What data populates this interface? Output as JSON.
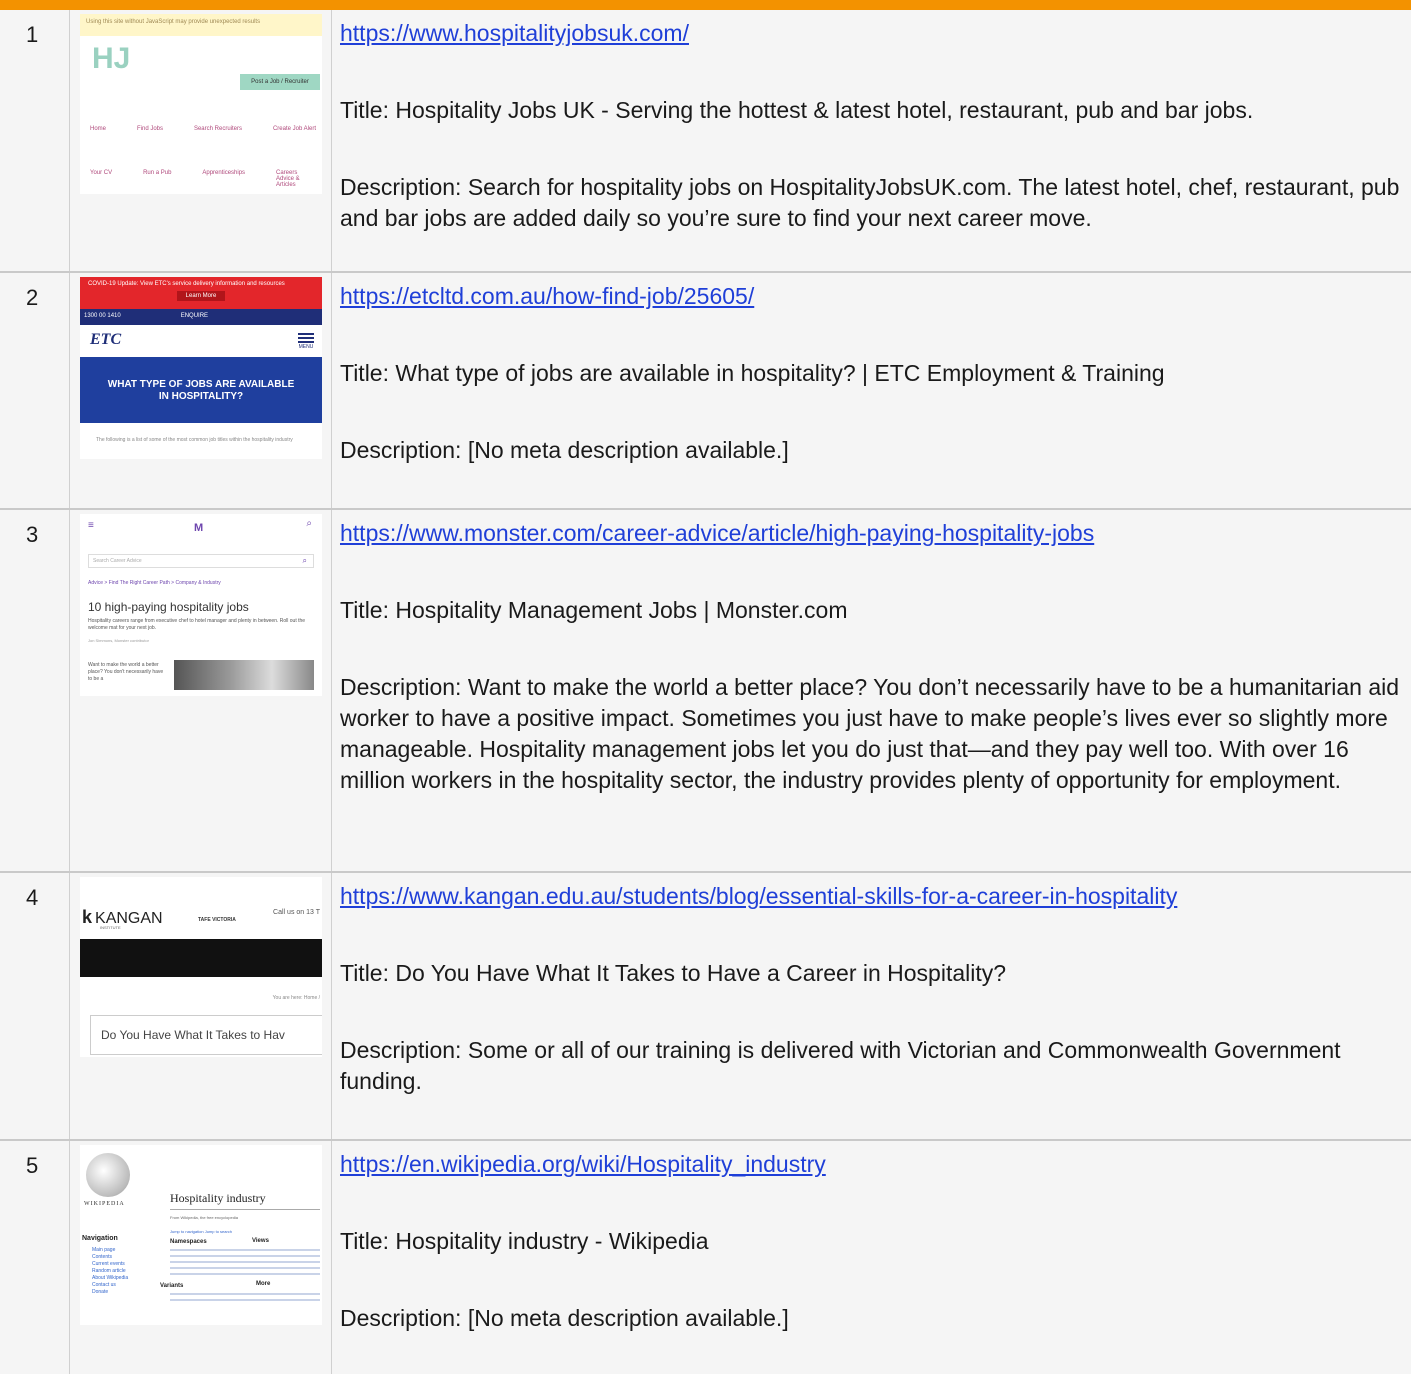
{
  "results": [
    {
      "num": "1",
      "url": "https://www.hospitalityjobsuk.com/",
      "title": "Title: Hospitality Jobs UK - Serving the hottest & latest hotel, restaurant, pub and bar jobs.",
      "description": "Description: Search for hospitality jobs on HospitalityJobsUK.com. The latest hotel, chef, restaurant, pub and bar jobs are added daily so you’re sure to find your next career move.",
      "thumb": {
        "banner": "Using this site without JavaScript may provide unexpected results",
        "logo": "HJ",
        "post_btn": "Post a Job / Recruiter",
        "nav1": [
          "Home",
          "Find Jobs",
          "Search Recruiters",
          "Create Job Alert"
        ],
        "nav2": [
          "Your CV",
          "Run a Pub",
          "Apprenticeships",
          "Careers Advice & Articles"
        ]
      }
    },
    {
      "num": "2",
      "url": "https://etcltd.com.au/how-find-job/25605/",
      "title": "Title: What type of jobs are available in hospitality? | ETC Employment & Training",
      "description": "Description: [No meta description available.]",
      "thumb": {
        "banner": "COVID-19 Update: View ETC's service delivery information and resources",
        "btn": "Learn More",
        "phone": "1300 00 1410",
        "enquire": "ENQUIRE",
        "logo": "ETC",
        "menu": "MENU",
        "hero": "WHAT TYPE OF JOBS ARE AVAILABLE IN HOSPITALITY?",
        "body": "The following is a list of some of the most common job titles within the hospitality industry"
      }
    },
    {
      "num": "3",
      "url": "https://www.monster.com/career-advice/article/high-paying-hospitality-jobs",
      "title": "Title: Hospitality Management Jobs | Monster.com",
      "description": "Description: Want to make the world a better place? You don’t necessarily have to be a humanitarian aid worker to have a positive impact. Sometimes you just have to make people’s lives ever so slightly more manageable. Hospitality management jobs let you do just that—and they pay well too. With over 16 million workers in the hospitality sector, the industry provides plenty of opportunity for employment.",
      "thumb": {
        "logo": "M",
        "search_placeholder": "Search Career Advice",
        "crumbs": "Advice > Find The Right Career Path > Company & Industry",
        "heading": "10 high-paying hospitality jobs",
        "lede": "Hospitality careers range from executive chef to hotel manager and plenty in between. Roll out the welcome mat for your next job.",
        "author": "Jon Simmons, Monster contributor",
        "teaser": "Want to make the world a better place? You don't necessarily have to be a"
      }
    },
    {
      "num": "4",
      "url": "https://www.kangan.edu.au/students/blog/essential-skills-for-a-career-in-hospitality",
      "title": "Title: Do You Have What It Takes to Have a Career in Hospitality?",
      "description": "Description: Some or all of our training is delivered with Victorian and Commonwealth Government funding.",
      "thumb": {
        "logo": "KANGAN",
        "sub": "INSTITUTE",
        "tafe": "TAFE VICTORIA",
        "call": "Call us on 13 T",
        "you_are": "You are here: Home / ",
        "heading": "Do You Have What It Takes to Hav"
      }
    },
    {
      "num": "5",
      "url": "https://en.wikipedia.org/wiki/Hospitality_industry",
      "title": "Title: Hospitality industry - Wikipedia",
      "description": "Description: [No meta description available.]",
      "thumb": {
        "heading": "Hospitality industry",
        "from": "From Wikipedia, the free encyclopedia",
        "jump": "Jump to navigation Jump to search",
        "nav_title": "Navigation",
        "nav": [
          "Main page",
          "Contents",
          "Current events",
          "Random article",
          "About Wikipedia",
          "Contact us",
          "Donate"
        ],
        "wordmark": "WIKIPEDIA",
        "namespaces": "Namespaces",
        "variants": "Variants",
        "views": "Views",
        "more": "More"
      }
    }
  ]
}
